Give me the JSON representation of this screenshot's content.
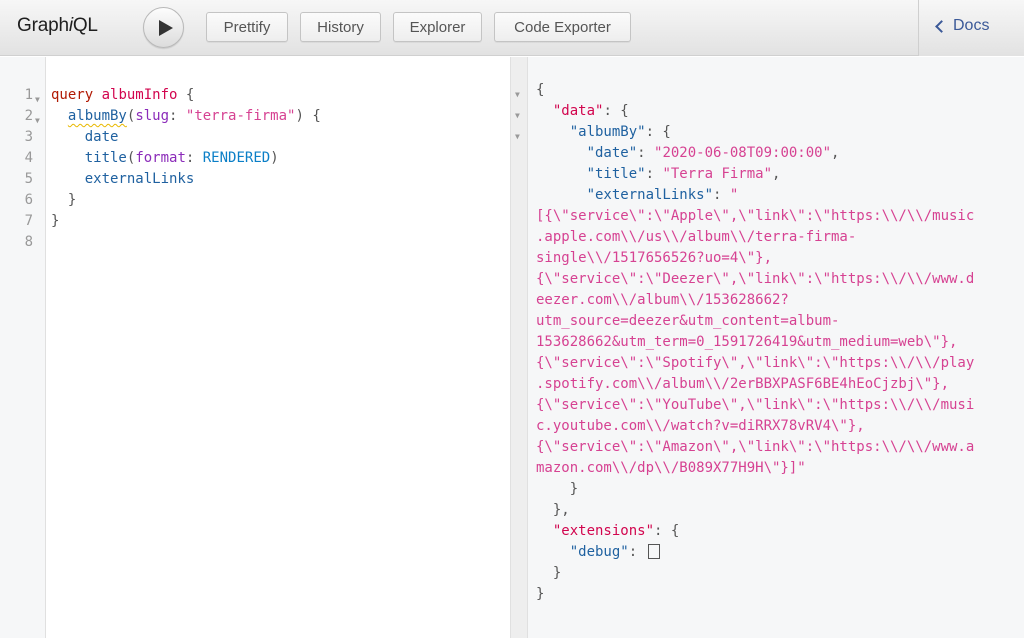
{
  "app": {
    "logo_prefix": "Graph",
    "logo_italic": "i",
    "logo_suffix": "QL"
  },
  "toolbar": {
    "run_icon": "play-icon",
    "buttons": [
      "Prettify",
      "History",
      "Explorer",
      "Code Exporter"
    ],
    "docs_label": "Docs",
    "docs_icon": "chevron-left-icon"
  },
  "query_editor": {
    "line_numbers": [
      "1",
      "2",
      "3",
      "4",
      "5",
      "6",
      "7",
      "8"
    ],
    "fold_marker": "▼",
    "lines": [
      [
        {
          "t": "query",
          "c": "kw"
        },
        {
          "t": " ",
          "c": ""
        },
        {
          "t": "albumInfo",
          "c": "def"
        },
        {
          "t": " {",
          "c": "punct"
        }
      ],
      [
        {
          "t": "  ",
          "c": ""
        },
        {
          "t": "albumBy",
          "c": "prop squiggle"
        },
        {
          "t": "(",
          "c": "punct"
        },
        {
          "t": "slug",
          "c": "arg"
        },
        {
          "t": ": ",
          "c": "punct"
        },
        {
          "t": "\"terra-firma\"",
          "c": "str"
        },
        {
          "t": ") {",
          "c": "punct"
        }
      ],
      [
        {
          "t": "    ",
          "c": ""
        },
        {
          "t": "date",
          "c": "prop"
        }
      ],
      [
        {
          "t": "    ",
          "c": ""
        },
        {
          "t": "title",
          "c": "prop"
        },
        {
          "t": "(",
          "c": "punct"
        },
        {
          "t": "format",
          "c": "arg"
        },
        {
          "t": ": ",
          "c": "punct"
        },
        {
          "t": "RENDERED",
          "c": "enum"
        },
        {
          "t": ")",
          "c": "punct"
        }
      ],
      [
        {
          "t": "    ",
          "c": ""
        },
        {
          "t": "externalLinks",
          "c": "prop"
        }
      ],
      [
        {
          "t": "  }",
          "c": "punct"
        }
      ],
      [
        {
          "t": "}",
          "c": "punct"
        }
      ],
      []
    ]
  },
  "result_viewer": {
    "fold_marker": "▼",
    "lines": [
      {
        "fold": true,
        "parts": [
          {
            "t": "{",
            "c": "punct"
          }
        ]
      },
      {
        "fold": true,
        "parts": [
          {
            "t": "  ",
            "c": ""
          },
          {
            "t": "\"data\"",
            "c": "topkey"
          },
          {
            "t": ": {",
            "c": "punct"
          }
        ]
      },
      {
        "fold": true,
        "parts": [
          {
            "t": "    ",
            "c": ""
          },
          {
            "t": "\"albumBy\"",
            "c": "key"
          },
          {
            "t": ": {",
            "c": "punct"
          }
        ]
      },
      {
        "fold": false,
        "parts": [
          {
            "t": "      ",
            "c": ""
          },
          {
            "t": "\"date\"",
            "c": "key"
          },
          {
            "t": ": ",
            "c": "punct"
          },
          {
            "t": "\"2020-06-08T09:00:00\"",
            "c": "str"
          },
          {
            "t": ",",
            "c": "punct"
          }
        ]
      },
      {
        "fold": false,
        "parts": [
          {
            "t": "      ",
            "c": ""
          },
          {
            "t": "\"title\"",
            "c": "key"
          },
          {
            "t": ": ",
            "c": "punct"
          },
          {
            "t": "\"Terra Firma\"",
            "c": "str"
          },
          {
            "t": ",",
            "c": "punct"
          }
        ]
      },
      {
        "fold": false,
        "parts": [
          {
            "t": "      ",
            "c": ""
          },
          {
            "t": "\"externalLinks\"",
            "c": "key"
          },
          {
            "t": ": ",
            "c": "punct"
          },
          {
            "t": "\"",
            "c": "str"
          }
        ]
      },
      {
        "fold": false,
        "parts": [
          {
            "t": "[{\\\"service\\\":\\\"Apple\\\",\\\"link\\\":\\\"https:\\\\/\\\\/music",
            "c": "str"
          }
        ]
      },
      {
        "fold": false,
        "parts": [
          {
            "t": ".apple.com\\\\/us\\\\/album\\\\/terra-firma-",
            "c": "str"
          }
        ]
      },
      {
        "fold": false,
        "parts": [
          {
            "t": "single\\\\/1517656526?uo=4\\\"},",
            "c": "str"
          }
        ]
      },
      {
        "fold": false,
        "parts": [
          {
            "t": "{\\\"service\\\":\\\"Deezer\\\",\\\"link\\\":\\\"https:\\\\/\\\\/www.d",
            "c": "str"
          }
        ]
      },
      {
        "fold": false,
        "parts": [
          {
            "t": "eezer.com\\\\/album\\\\/153628662?",
            "c": "str"
          }
        ]
      },
      {
        "fold": false,
        "parts": [
          {
            "t": "utm_source=deezer&utm_content=album-",
            "c": "str"
          }
        ]
      },
      {
        "fold": false,
        "parts": [
          {
            "t": "153628662&utm_term=0_1591726419&utm_medium=web\\\"},",
            "c": "str"
          }
        ]
      },
      {
        "fold": false,
        "parts": [
          {
            "t": "{\\\"service\\\":\\\"Spotify\\\",\\\"link\\\":\\\"https:\\\\/\\\\/play",
            "c": "str"
          }
        ]
      },
      {
        "fold": false,
        "parts": [
          {
            "t": ".spotify.com\\\\/album\\\\/2erBBXPASF6BE4hEoCjzbj\\\"},",
            "c": "str"
          }
        ]
      },
      {
        "fold": false,
        "parts": [
          {
            "t": "{\\\"service\\\":\\\"YouTube\\\",\\\"link\\\":\\\"https:\\\\/\\\\/musi",
            "c": "str"
          }
        ]
      },
      {
        "fold": false,
        "parts": [
          {
            "t": "c.youtube.com\\\\/watch?v=diRRX78vRV4\\\"},",
            "c": "str"
          }
        ]
      },
      {
        "fold": false,
        "parts": [
          {
            "t": "{\\\"service\\\":\\\"Amazon\\\",\\\"link\\\":\\\"https:\\\\/\\\\/www.a",
            "c": "str"
          }
        ]
      },
      {
        "fold": false,
        "parts": [
          {
            "t": "mazon.com\\\\/dp\\\\/B089X77H9H\\\"}]\"",
            "c": "str"
          }
        ]
      },
      {
        "fold": false,
        "parts": [
          {
            "t": "    }",
            "c": "punct"
          }
        ]
      },
      {
        "fold": false,
        "parts": [
          {
            "t": "  },",
            "c": "punct"
          }
        ]
      },
      {
        "fold": false,
        "parts": [
          {
            "t": "  ",
            "c": ""
          },
          {
            "t": "\"extensions\"",
            "c": "topkey"
          },
          {
            "t": ": {",
            "c": "punct"
          }
        ]
      },
      {
        "fold": false,
        "parts": [
          {
            "t": "    ",
            "c": ""
          },
          {
            "t": "\"debug\"",
            "c": "key"
          },
          {
            "t": ": ",
            "c": "punct"
          },
          {
            "t": "[]",
            "c": "emptybox"
          }
        ]
      },
      {
        "fold": false,
        "parts": [
          {
            "t": "  }",
            "c": "punct"
          }
        ]
      },
      {
        "fold": false,
        "parts": [
          {
            "t": "}",
            "c": "punct"
          }
        ]
      }
    ]
  },
  "colors": {
    "keyword": "#b11a04",
    "definition": "#d2054e",
    "property": "#1f61a0",
    "argument": "#8b2bb9",
    "string": "#d64292",
    "enum": "#0b7fc7",
    "docs_link": "#3b5998"
  }
}
